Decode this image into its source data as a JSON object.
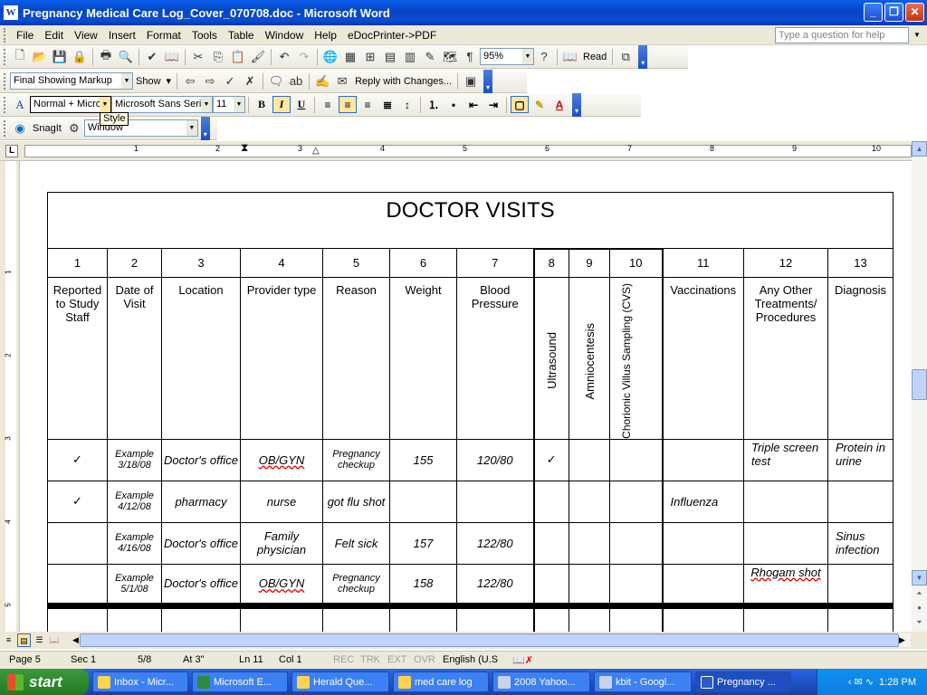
{
  "window": {
    "title": "Pregnancy Medical Care Log_Cover_070708.doc - Microsoft Word",
    "app_icon": "W"
  },
  "menu": {
    "items": [
      "File",
      "Edit",
      "View",
      "Insert",
      "Format",
      "Tools",
      "Table",
      "Window",
      "Help",
      "eDocPrinter->PDF"
    ],
    "help_placeholder": "Type a question for help"
  },
  "standard_toolbar": {
    "zoom": "95%",
    "read_label": "Read"
  },
  "reviewing_toolbar": {
    "display_mode": "Final Showing Markup",
    "show_label": "Show",
    "reply_label": "Reply with Changes..."
  },
  "formatting_toolbar": {
    "style": "Normal + Micro",
    "font": "Microsoft Sans Serif",
    "size": "11",
    "tooltip": "Style"
  },
  "snagit_toolbar": {
    "snagit_label": "SnagIt",
    "capture_mode": "Window"
  },
  "ruler": {
    "ticks": [
      "1",
      "2",
      "3",
      "4",
      "5",
      "6",
      "7",
      "8",
      "9",
      "10"
    ]
  },
  "vruler": {
    "ticks": [
      "1",
      "2",
      "3",
      "4",
      "5"
    ]
  },
  "document": {
    "table_title": "DOCTOR VISITS",
    "column_numbers": [
      "1",
      "2",
      "3",
      "4",
      "5",
      "6",
      "7",
      "8",
      "9",
      "10",
      "11",
      "12",
      "13"
    ],
    "column_headers": {
      "c1": "Reported to Study Staff",
      "c2": "Date of Visit",
      "c3": "Location",
      "c4": "Provider type",
      "c5": "Reason",
      "c6": "Weight",
      "c7": "Blood Pressure",
      "c8": "Ultrasound",
      "c9": "Amniocentesis",
      "c10": "Chorionic Villus Sampling (CVS)",
      "c11": "Vaccinations",
      "c12": "Any Other Treatments/ Procedures",
      "c13": "Diagnosis"
    },
    "rows": [
      {
        "reported": "✓",
        "date": "Example 3/18/08",
        "location": "Doctor's office",
        "provider": "OB/GYN",
        "reason": "Pregnancy checkup",
        "weight": "155",
        "bp": "120/80",
        "ultrasound": "✓",
        "amnio": "",
        "cvs": "",
        "vaccinations": "",
        "other": "Triple screen test",
        "diagnosis": "Protein in urine"
      },
      {
        "reported": "✓",
        "date": "Example 4/12/08",
        "location": "pharmacy",
        "provider": "nurse",
        "reason": "got flu shot",
        "weight": "",
        "bp": "",
        "ultrasound": "",
        "amnio": "",
        "cvs": "",
        "vaccinations": "Influenza",
        "other": "",
        "diagnosis": ""
      },
      {
        "reported": "",
        "date": "Example 4/16/08",
        "location": "Doctor's office",
        "provider": "Family physician",
        "reason": "Felt sick",
        "weight": "157",
        "bp": "122/80",
        "ultrasound": "",
        "amnio": "",
        "cvs": "",
        "vaccinations": "",
        "other": "",
        "diagnosis": "Sinus infection"
      },
      {
        "reported": "",
        "date": "Example 5/1/08",
        "location": "Doctor's office",
        "provider": "OB/GYN",
        "reason": "Pregnancy checkup",
        "weight": "158",
        "bp": "122/80",
        "ultrasound": "",
        "amnio": "",
        "cvs": "",
        "vaccinations": "",
        "other": "Rhogam shot",
        "diagnosis": ""
      }
    ]
  },
  "status": {
    "page": "Page 5",
    "sec": "Sec 1",
    "pages": "5/8",
    "at": "At 3\"",
    "ln": "Ln 11",
    "col": "Col 1",
    "rec": "REC",
    "trk": "TRK",
    "ext": "EXT",
    "ovr": "OVR",
    "lang": "English (U.S"
  },
  "taskbar": {
    "start": "start",
    "tasks": [
      "Inbox - Micr...",
      "Microsoft E...",
      "Herald Que...",
      "med care log",
      "2008 Yahoo...",
      "kbit - Googl...",
      "Pregnancy ..."
    ],
    "clock": "1:28 PM"
  }
}
